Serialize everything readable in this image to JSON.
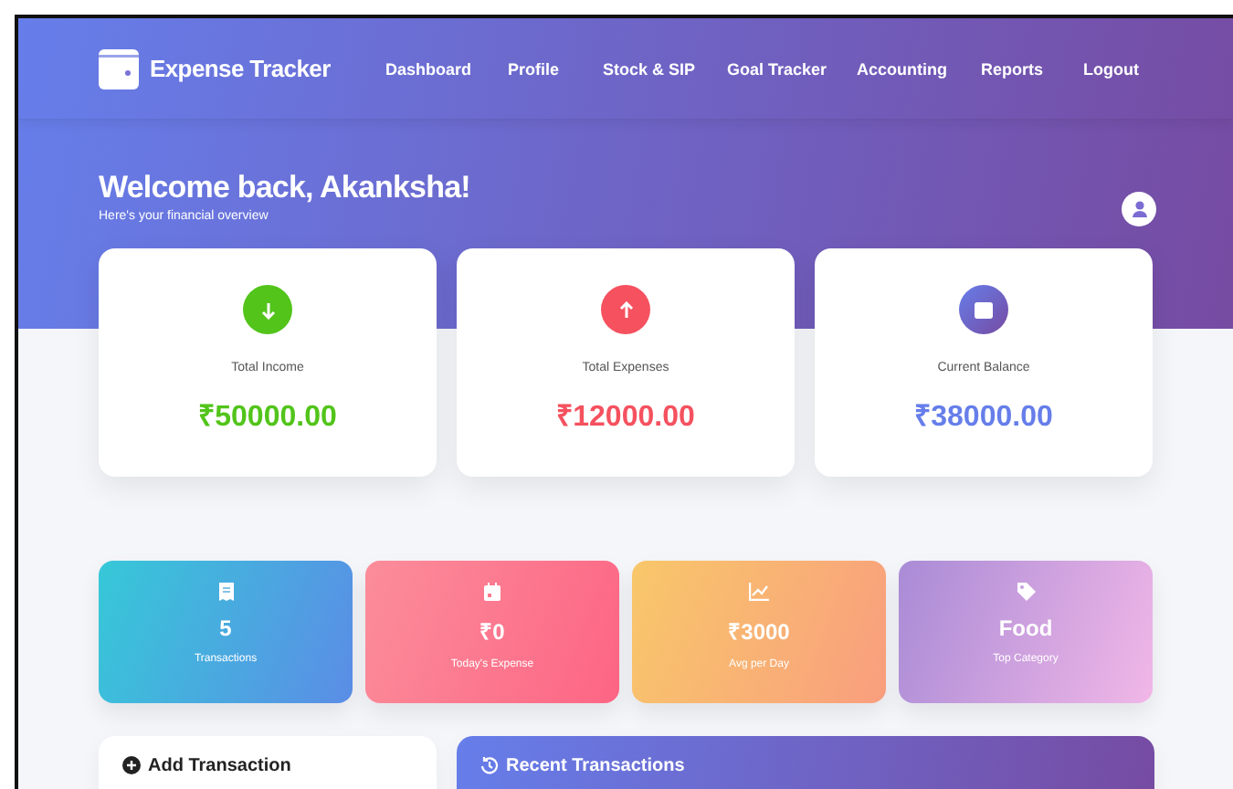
{
  "brand": "Expense Tracker",
  "nav": [
    "Dashboard",
    "Profile",
    "Stock & SIP",
    "Goal Tracker",
    "Accounting",
    "Reports",
    "Logout"
  ],
  "welcome": {
    "title": "Welcome back, Akanksha!",
    "subtitle": "Here's your financial overview"
  },
  "summary": [
    {
      "kind": "income",
      "label": "Total Income",
      "value": "₹50000.00",
      "color": "#52c41a"
    },
    {
      "kind": "expense",
      "label": "Total Expenses",
      "value": "₹12000.00",
      "color": "#f5515f"
    },
    {
      "kind": "balance",
      "label": "Current Balance",
      "value": "₹38000.00",
      "color": "#667eea"
    }
  ],
  "stats": [
    {
      "kind": "receipt",
      "value": "5",
      "label": "Transactions"
    },
    {
      "kind": "calendar",
      "value": "₹0",
      "label": "Today's Expense"
    },
    {
      "kind": "chart",
      "value": "₹3000",
      "label": "Avg per Day"
    },
    {
      "kind": "tag",
      "value": "Food",
      "label": "Top Category"
    }
  ],
  "panels": [
    {
      "kind": "add",
      "title": "Add Transaction"
    },
    {
      "kind": "history",
      "title": "Recent Transactions"
    }
  ]
}
